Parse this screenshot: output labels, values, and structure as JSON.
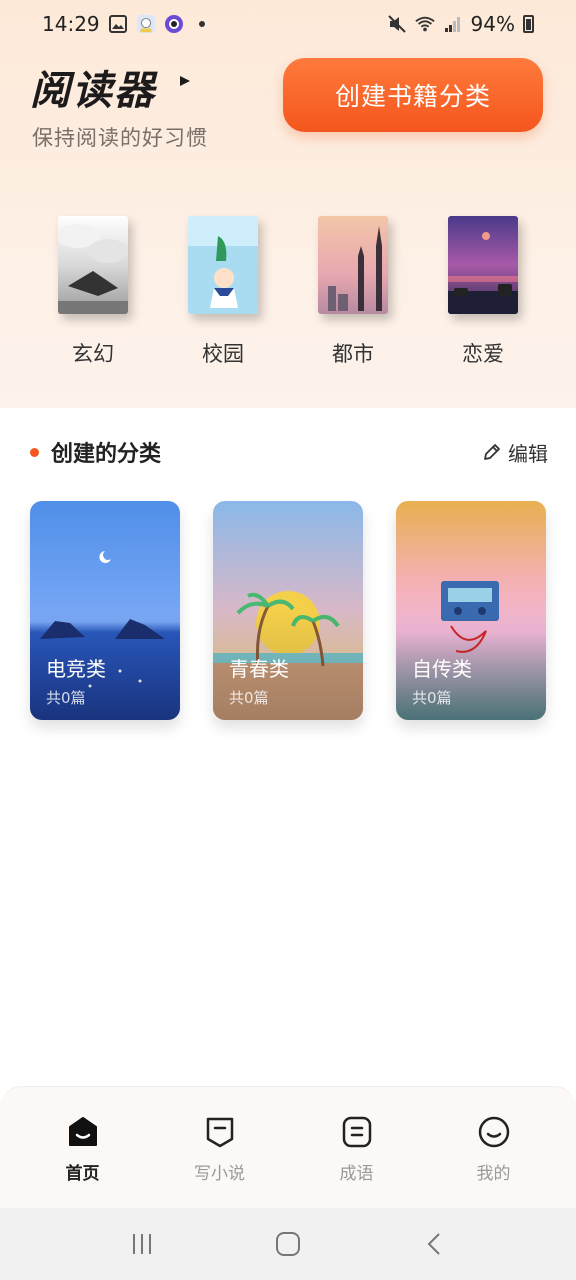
{
  "status_bar": {
    "time": "14:29",
    "battery": "94%"
  },
  "header": {
    "title": "阅读器",
    "subtitle": "保持阅读的好习惯",
    "create_button": "创建书籍分类"
  },
  "genres": [
    {
      "label": "玄幻"
    },
    {
      "label": "校园"
    },
    {
      "label": "都市"
    },
    {
      "label": "恋爱"
    }
  ],
  "section": {
    "title": "创建的分类",
    "edit_label": "编辑"
  },
  "categories": [
    {
      "name": "电竞类",
      "count": "共0篇"
    },
    {
      "name": "青春类",
      "count": "共0篇"
    },
    {
      "name": "自传类",
      "count": "共0篇"
    }
  ],
  "bottom_nav": [
    {
      "label": "首页",
      "icon": "home-icon",
      "active": true
    },
    {
      "label": "写小说",
      "icon": "write-icon",
      "active": false
    },
    {
      "label": "成语",
      "icon": "idiom-icon",
      "active": false
    },
    {
      "label": "我的",
      "icon": "profile-icon",
      "active": false
    }
  ],
  "colors": {
    "accent": "#f4561d",
    "background": "#ffffff",
    "header_bg": "#fde9d8"
  }
}
